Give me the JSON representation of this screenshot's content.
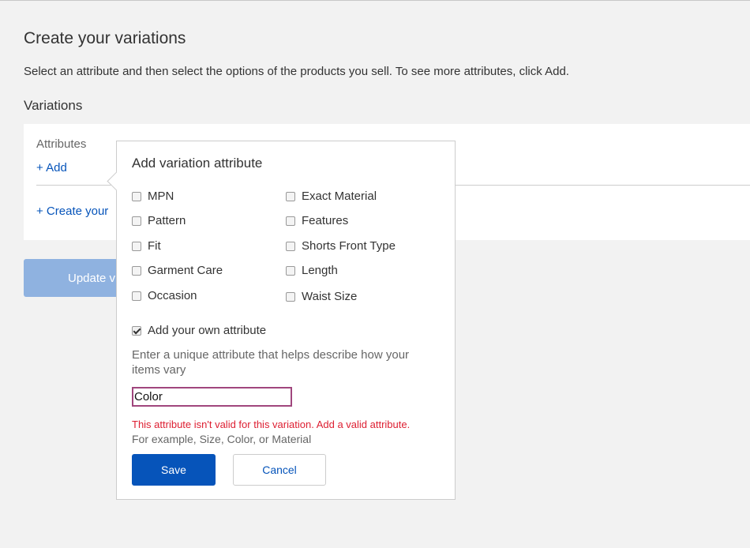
{
  "page": {
    "title": "Create your variations",
    "description": "Select an attribute and then select the options of the products you sell. To see more attributes, click Add.",
    "section_title": "Variations"
  },
  "panel": {
    "attributes_label": "Attributes",
    "add_link": "+ Add",
    "create_link": "+ Create your"
  },
  "update_button": {
    "label": "Update v"
  },
  "popover": {
    "title": "Add variation attribute",
    "options_left": [
      {
        "label": "MPN",
        "checked": false
      },
      {
        "label": "Pattern",
        "checked": false
      },
      {
        "label": "Fit",
        "checked": false
      },
      {
        "label": "Garment Care",
        "checked": false
      },
      {
        "label": "Occasion",
        "checked": false
      }
    ],
    "options_right": [
      {
        "label": "Exact Material",
        "checked": false
      },
      {
        "label": "Features",
        "checked": false
      },
      {
        "label": "Shorts Front Type",
        "checked": false
      },
      {
        "label": "Length",
        "checked": false
      },
      {
        "label": "Waist Size",
        "checked": false
      }
    ],
    "own_attribute": {
      "label": "Add your own attribute",
      "checked": true
    },
    "hint": "Enter a unique attribute that helps describe how your items vary",
    "input_value": "Color",
    "error": "This attribute isn't valid for this variation. Add a valid attribute.",
    "example": "For example, Size, Color, or Material",
    "save_label": "Save",
    "cancel_label": "Cancel"
  },
  "colors": {
    "link": "#0654ba",
    "primary_button": "#0654ba",
    "disabled_button": "#8fb2e0",
    "error": "#dd1e31",
    "input_border": "#a0467d"
  }
}
